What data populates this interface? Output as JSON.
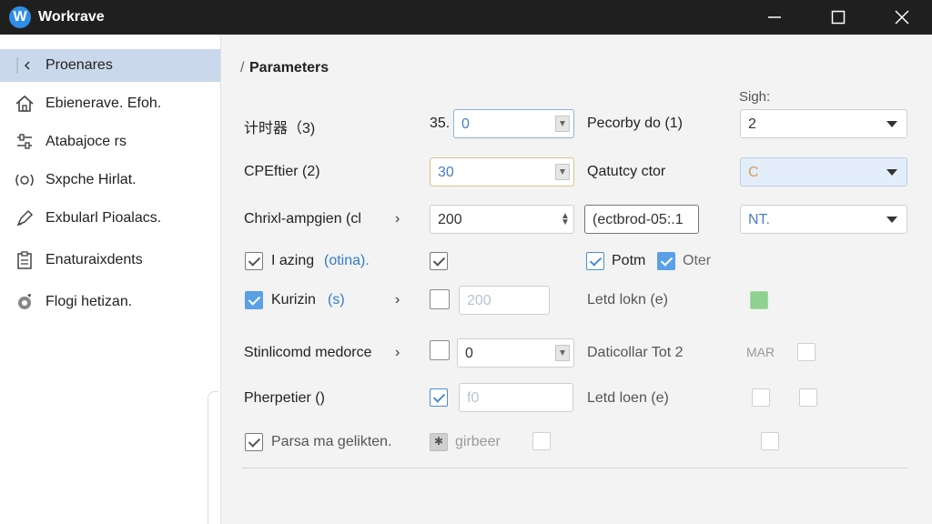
{
  "app": {
    "logo": "W",
    "title": "Workrave"
  },
  "sidebar": {
    "items": [
      {
        "label": "Proenares",
        "icon": "chevron-left-icon"
      },
      {
        "label": "Ebienerave. Efoh.",
        "icon": "home-icon"
      },
      {
        "label": "Atabajoce rs",
        "icon": "sliders-icon"
      },
      {
        "label": "Sxpche Hirlat.",
        "icon": "sound-icon"
      },
      {
        "label": "Exbularl Pioalacs.",
        "icon": "pen-icon"
      },
      {
        "label": "Enaturaixdents",
        "icon": "clipboard-icon"
      },
      {
        "label": "Flogi hetizan.",
        "icon": "gear-icon"
      }
    ]
  },
  "main": {
    "section_title": "Parameters",
    "column_header": "Sigh:",
    "rows": {
      "r1": {
        "label": "计时器（3)",
        "prefix": "35.",
        "value": "0",
        "label2": "Pecorby do (1)",
        "select": "2"
      },
      "r2": {
        "label": "CPEftier (2)",
        "value": "30",
        "label2": "Qatutcy ctor",
        "select": "C"
      },
      "r3": {
        "label": "Chrixl-ampgien (cl",
        "value": "200",
        "field2": "(ectbrod-05:.1",
        "select": "NT."
      },
      "r4": {
        "label_a": "I azing",
        "label_b": "(otina).",
        "label2": "Potm",
        "label3": "Oter"
      },
      "r5": {
        "label": "Kurizin",
        "label_b": "(s)",
        "value": "200",
        "label2": "Letd lokn (e)"
      },
      "r6": {
        "label": "Stinlicomd medorce",
        "value": "0",
        "label2": "Daticollar Tot 2",
        "label3": "MAR"
      },
      "r7": {
        "label": "Pherpetier ()",
        "value": "f0",
        "label2": "Letd loen (e)"
      },
      "r8": {
        "label": "Parsa ma gelikten.",
        "label2": "girbeer"
      }
    }
  },
  "colors": {
    "titlebar": "#1f1f1f",
    "accent": "#5aa0e6",
    "sidebar_active": "#c9d8ea"
  }
}
